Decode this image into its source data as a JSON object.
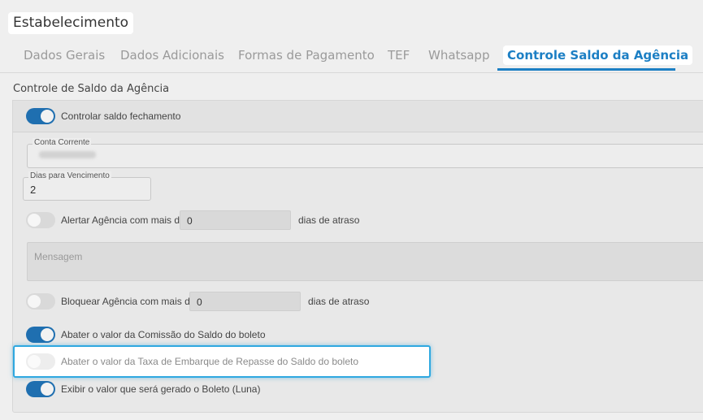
{
  "page": {
    "title": "Estabelecimento"
  },
  "tabs": [
    {
      "label": "Dados Gerais",
      "active": false
    },
    {
      "label": "Dados Adicionais",
      "active": false
    },
    {
      "label": "Formas de Pagamento",
      "active": false
    },
    {
      "label": "TEF",
      "active": false
    },
    {
      "label": "Whatsapp",
      "active": false
    },
    {
      "label": "Controle Saldo da Agência",
      "active": true
    }
  ],
  "colors": {
    "accent": "#1c7fc4",
    "toggle_on": "#1f6fb0",
    "highlight": "#2fa8e0"
  },
  "section": {
    "title": "Controle de Saldo da Agência",
    "controlar": {
      "label": "Controlar saldo fechamento",
      "on": true
    },
    "conta_corrente": {
      "legend": "Conta Corrente",
      "value": ""
    },
    "dias_vencimento": {
      "legend": "Dias para Vencimento",
      "value": "2"
    },
    "alertar": {
      "label": "Alertar Agência com mais de",
      "value": "0",
      "suffix": "dias de atraso",
      "on": false
    },
    "mensagem": {
      "placeholder": "Mensagem"
    },
    "bloquear": {
      "label": "Bloquear Agência com mais de",
      "value": "0",
      "suffix": "dias de atraso",
      "on": false
    },
    "abater_comissao": {
      "label": "Abater o valor da Comissão do Saldo do boleto",
      "on": true
    },
    "abater_taxa": {
      "label": "Abater o valor da Taxa de Embarque de Repasse do Saldo do boleto",
      "on": false
    },
    "exibir_valor": {
      "label": "Exibir o valor que será gerado o Boleto (Luna)",
      "on": true
    }
  }
}
